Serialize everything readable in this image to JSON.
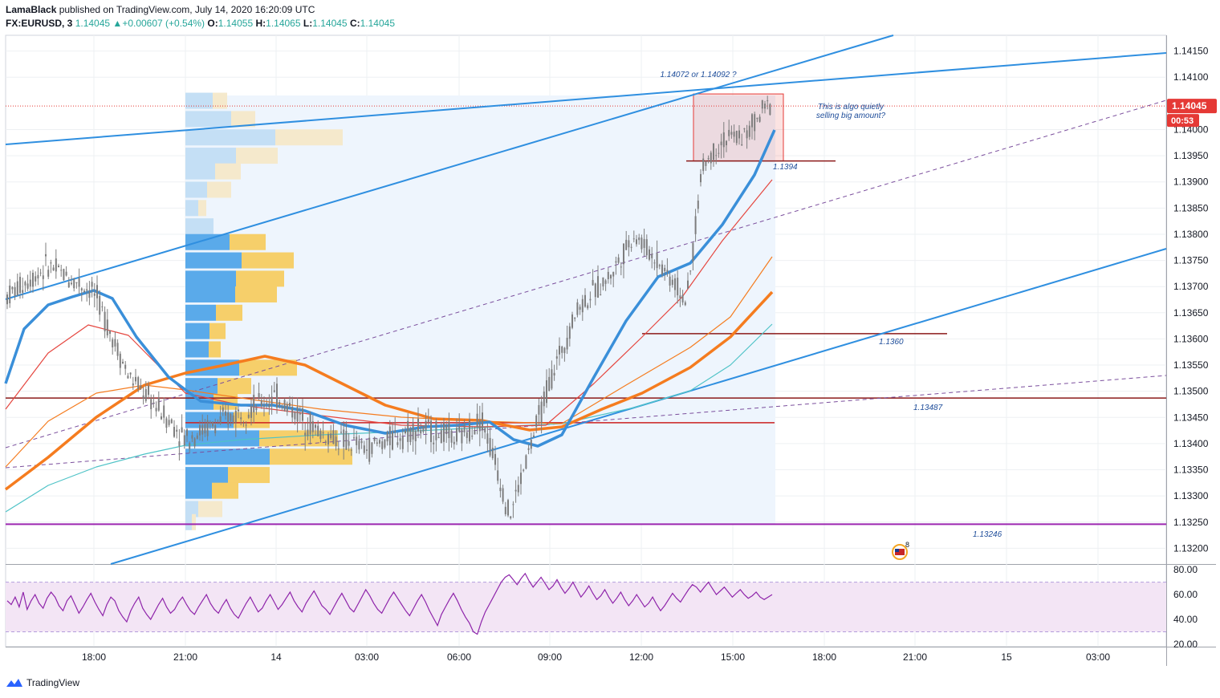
{
  "header": {
    "publisher": "LamaBlack",
    "published_text": " published on TradingView.com, July 14, 2020 16:20:09 UTC",
    "symbol": "FX:EURUSD, 3",
    "last": "1.14045",
    "arrow": "▲",
    "change": "+0.00607 (+0.54%)",
    "o_label": "O:",
    "o_value": "1.14055",
    "h_label": "H:",
    "h_value": "1.14065",
    "l_label": "L:",
    "l_value": "1.14045",
    "c_label": "C:",
    "c_value": "1.14045"
  },
  "brand": {
    "name": "TradingView",
    "icon": "tradingview-logo-icon"
  },
  "colors": {
    "channel": "#2f8fe0",
    "ema_thick_blue": "#3a8fd9",
    "ema_orange": "#f57c1f",
    "ema_red": "#e5463f",
    "ema_teal": "#4fc3c7",
    "dashed_purple": "#7b4f9d",
    "support_red": "#cc2020",
    "level_darkred": "#8b1a1a",
    "purple_level": "#9c27b0",
    "candle": "#7d7d7d",
    "vp_blue": "#5aaaea",
    "vp_yellow": "#f6cf6a",
    "vp_blue_light": "#c4dff5",
    "vp_yellow_light": "#f5e9cc",
    "rsi_line": "#8e24aa",
    "rsi_band": "#f3e5f5",
    "price_tag": "#e53935"
  },
  "chart_data": {
    "type": "candlestick",
    "symbol": "FX:EURUSD",
    "timeframe": "3",
    "price_axis": {
      "ticks": [
        "1.14150",
        "1.14100",
        "1.14045",
        "1.14000",
        "1.13950",
        "1.13900",
        "1.13850",
        "1.13800",
        "1.13750",
        "1.13700",
        "1.13650",
        "1.13600",
        "1.13550",
        "1.13500",
        "1.13450",
        "1.13400",
        "1.13350",
        "1.13300",
        "1.13250",
        "1.13200"
      ],
      "ylim": [
        1.1317,
        1.1418
      ]
    },
    "time_axis": {
      "ticks": [
        "18:00",
        "21:00",
        "14",
        "03:00",
        "06:00",
        "09:00",
        "12:00",
        "15:00",
        "18:00",
        "21:00",
        "15",
        "03:00"
      ]
    },
    "current_price": "1.14045",
    "countdown": "00:53",
    "levels": [
      {
        "label": "1.1394",
        "price": 1.1394,
        "color": "level_darkred"
      },
      {
        "label": "1.1360",
        "price": 1.1361,
        "color": "level_darkred"
      },
      {
        "label": "1.13487",
        "price": 1.13487,
        "color": "level_darkred"
      },
      {
        "label": "1.13246",
        "price": 1.13246,
        "color": "purple_level"
      },
      {
        "label": "",
        "price": 1.1344,
        "color": "support_red"
      }
    ],
    "annotations": [
      {
        "text": "1.14072 or 1.14092 ?"
      },
      {
        "text": "This is algo quietly"
      },
      {
        "text": "selling big amount?"
      },
      {
        "text": "1.1394"
      },
      {
        "text": "1.1360"
      },
      {
        "text": "1.13487"
      },
      {
        "text": "1.13246"
      }
    ],
    "rsi": {
      "ticks": [
        "80.00",
        "60.00",
        "40.00",
        "20.00"
      ],
      "ylim": [
        18,
        84
      ],
      "upper": 70,
      "lower": 30,
      "values": [
        55,
        52,
        58,
        50,
        62,
        48,
        55,
        60,
        53,
        49,
        57,
        62,
        58,
        51,
        47,
        55,
        59,
        52,
        45,
        50,
        56,
        61,
        54,
        48,
        43,
        52,
        58,
        55,
        47,
        42,
        38,
        47,
        53,
        58,
        49,
        44,
        40,
        46,
        52,
        57,
        50,
        45,
        48,
        54,
        58,
        52,
        47,
        44,
        50,
        55,
        60,
        53,
        48,
        45,
        51,
        56,
        49,
        44,
        41,
        47,
        53,
        58,
        52,
        46,
        49,
        55,
        60,
        54,
        48,
        52,
        57,
        62,
        55,
        50,
        46,
        53,
        58,
        63,
        57,
        51,
        48,
        44,
        50,
        56,
        61,
        55,
        49,
        46,
        52,
        58,
        64,
        59,
        53,
        48,
        45,
        51,
        57,
        62,
        57,
        52,
        47,
        43,
        49,
        55,
        60,
        54,
        47,
        41,
        35,
        44,
        50,
        56,
        61,
        55,
        48,
        42,
        37,
        30,
        28,
        38,
        46,
        52,
        58,
        64,
        70,
        74,
        76,
        72,
        68,
        73,
        77,
        71,
        66,
        70,
        74,
        69,
        64,
        67,
        72,
        66,
        61,
        65,
        70,
        64,
        58,
        62,
        67,
        61,
        56,
        59,
        64,
        58,
        53,
        57,
        62,
        56,
        51,
        55,
        60,
        55,
        50,
        53,
        58,
        52,
        47,
        51,
        56,
        61,
        57,
        54,
        59,
        64,
        68,
        66,
        62,
        66,
        70,
        65,
        60,
        63,
        66,
        62,
        58,
        61,
        64,
        60,
        57,
        59,
        62,
        58,
        56,
        58,
        60
      ]
    },
    "candles": []
  }
}
